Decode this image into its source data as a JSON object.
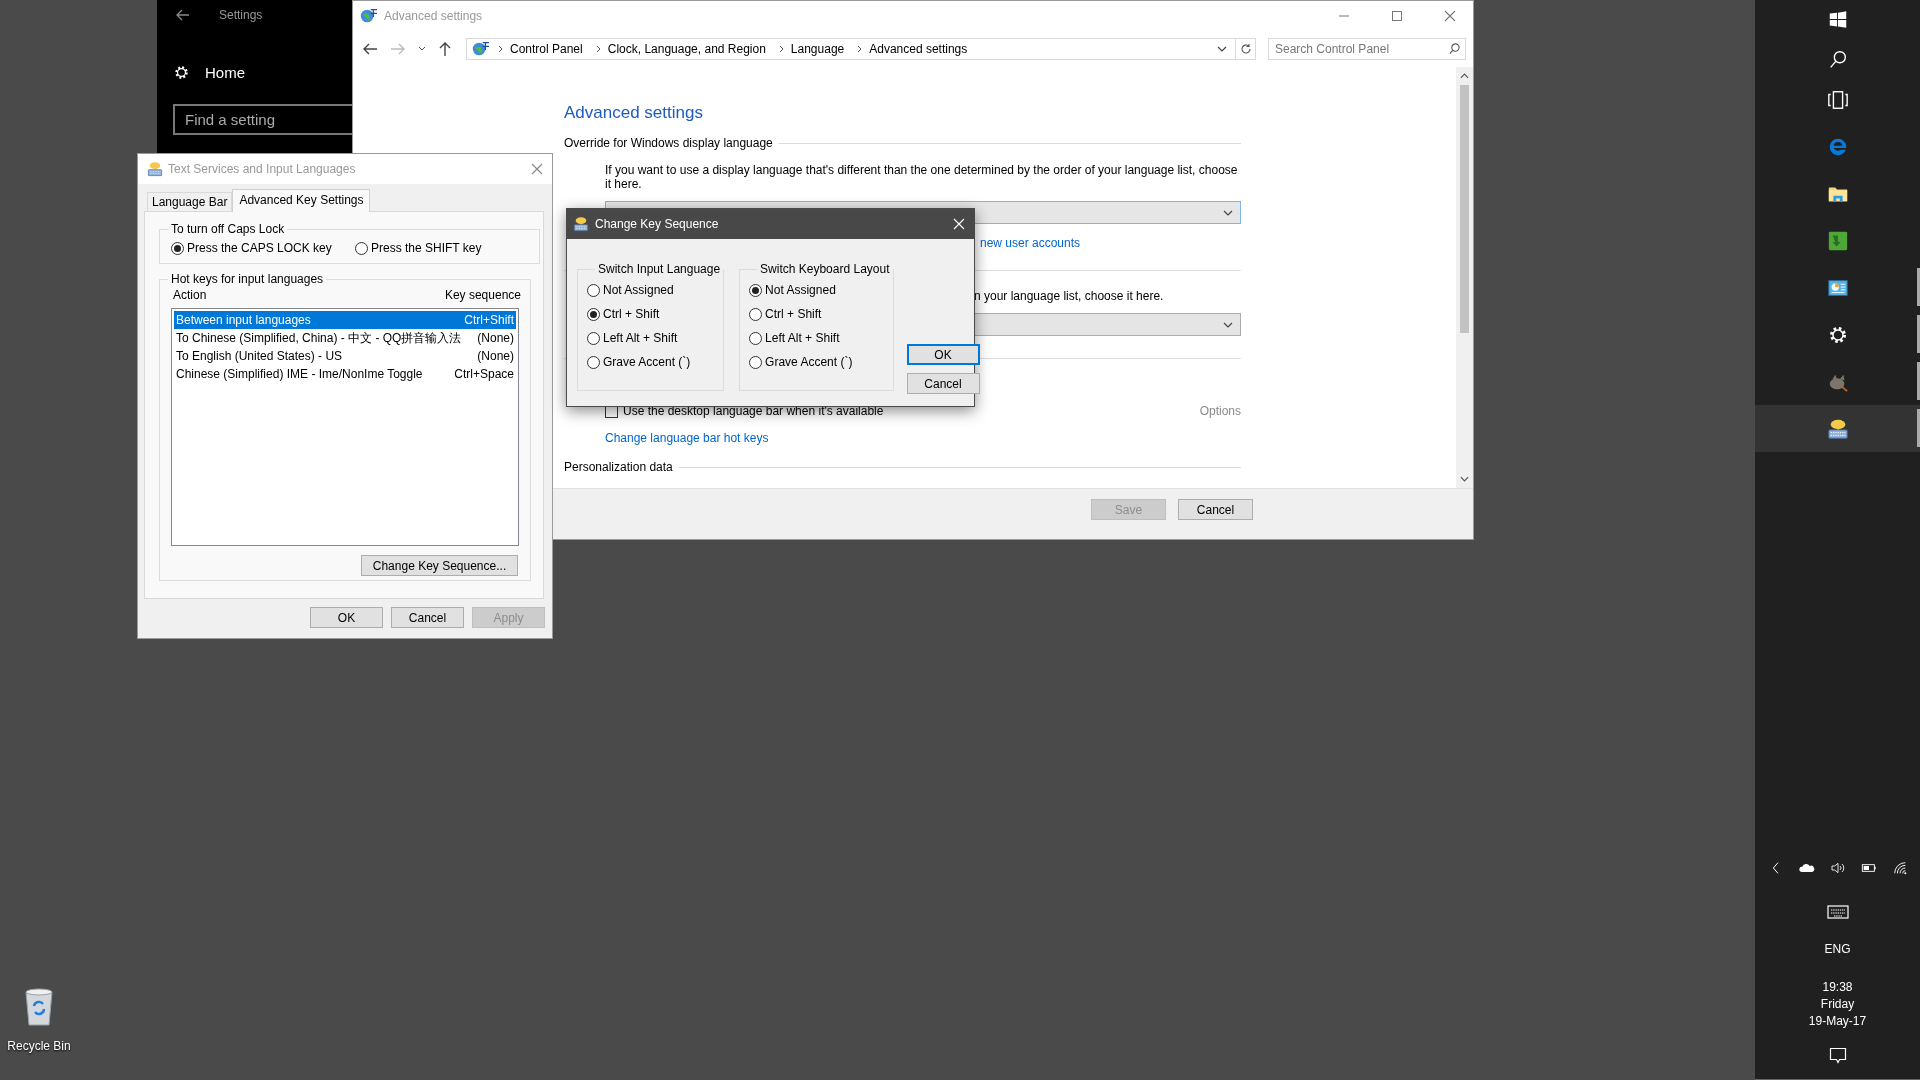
{
  "settings_window": {
    "title": "Settings",
    "home": "Home",
    "search": {
      "placeholder": "Find a setting"
    }
  },
  "advanced_window": {
    "title": "Advanced settings",
    "breadcrumb": [
      "Control Panel",
      "Clock, Language, and Region",
      "Language",
      "Advanced settings"
    ],
    "search": {
      "placeholder": "Search Control Panel"
    },
    "heading": "Advanced settings",
    "override_label": "Override for Windows display language",
    "override_text": "If you want to use a display language that's different than the one determined by the order of your language list, choose it here.",
    "accounts_link": "new user accounts",
    "input_method_text": "n your language list, choose it here.",
    "language_bar_checkbox": {
      "label": "Use the desktop language bar when it's available",
      "checked": false
    },
    "options_link": {
      "label": "Options",
      "disabled": true
    },
    "hotkeys_link": "Change language bar hot keys",
    "personalization_label": "Personalization data",
    "buttons": [
      {
        "label": "Save",
        "disabled": true
      },
      {
        "label": "Cancel",
        "disabled": false
      }
    ]
  },
  "text_services_dialog": {
    "title": "Text Services and Input Languages",
    "tabs": [
      {
        "label": "Language Bar",
        "selected": false
      },
      {
        "label": "Advanced Key Settings",
        "selected": true
      }
    ],
    "caps_lock": {
      "label": "To turn off Caps Lock",
      "options": [
        {
          "label": "Press the CAPS LOCK key",
          "selected": true
        },
        {
          "label": "Press the SHIFT key",
          "selected": false
        }
      ]
    },
    "hot_keys": {
      "label": "Hot keys for input languages",
      "columns": [
        "Action",
        "Key sequence"
      ],
      "rows": [
        {
          "action": "Between input languages",
          "key_sequence": "Ctrl+Shift",
          "selected": true
        },
        {
          "action": "To Chinese (Simplified, China) - 中文 - QQ拼音输入法",
          "key_sequence": "(None)",
          "selected": false
        },
        {
          "action": "To English (United States) - US",
          "key_sequence": "(None)",
          "selected": false
        },
        {
          "action": "Chinese (Simplified) IME - Ime/NonIme Toggle",
          "key_sequence": "Ctrl+Space",
          "selected": false
        }
      ],
      "change_button": "Change Key Sequence..."
    },
    "buttons": [
      {
        "label": "OK",
        "disabled": false
      },
      {
        "label": "Cancel",
        "disabled": false
      },
      {
        "label": "Apply",
        "disabled": true
      }
    ]
  },
  "change_key_sequence_dialog": {
    "title": "Change Key Sequence",
    "groups": [
      {
        "label": "Switch Input Language",
        "options": [
          {
            "label": "Not Assigned",
            "selected": false
          },
          {
            "label": "Ctrl + Shift",
            "selected": true
          },
          {
            "label": "Left Alt + Shift",
            "selected": false
          },
          {
            "label": "Grave Accent (`)",
            "selected": false
          }
        ]
      },
      {
        "label": "Switch Keyboard Layout",
        "options": [
          {
            "label": "Not Assigned",
            "selected": true
          },
          {
            "label": "Ctrl + Shift",
            "selected": false
          },
          {
            "label": "Left Alt + Shift",
            "selected": false
          },
          {
            "label": "Grave Accent (`)",
            "selected": false
          }
        ]
      }
    ],
    "buttons": [
      {
        "label": "OK",
        "focused": true
      },
      {
        "label": "Cancel",
        "focused": false
      }
    ]
  },
  "taskbar": {
    "items": [
      {
        "kind": "start",
        "running": false,
        "active": false
      },
      {
        "kind": "search",
        "running": false,
        "active": false
      },
      {
        "kind": "task_view",
        "running": false,
        "active": false
      },
      {
        "kind": "browser",
        "running": false,
        "active": false
      },
      {
        "kind": "file_explorer",
        "running": false,
        "active": false
      },
      {
        "kind": "download_app",
        "running": false,
        "active": false
      },
      {
        "kind": "control_panel",
        "running": true,
        "active": false
      },
      {
        "kind": "settings",
        "running": true,
        "active": false
      },
      {
        "kind": "image_editor",
        "running": true,
        "active": false
      },
      {
        "kind": "language_bar",
        "running": true,
        "active": true
      }
    ],
    "tray_icons": [
      {
        "kind": "chevron"
      },
      {
        "kind": "cloud"
      },
      {
        "kind": "volume"
      },
      {
        "kind": "battery"
      },
      {
        "kind": "network"
      }
    ],
    "input_indicator": "ENG",
    "clock": {
      "time": "19:38",
      "day": "Friday",
      "date": "19-May-17"
    }
  },
  "desktop_icons": [
    {
      "label": "Recycle Bin"
    }
  ]
}
